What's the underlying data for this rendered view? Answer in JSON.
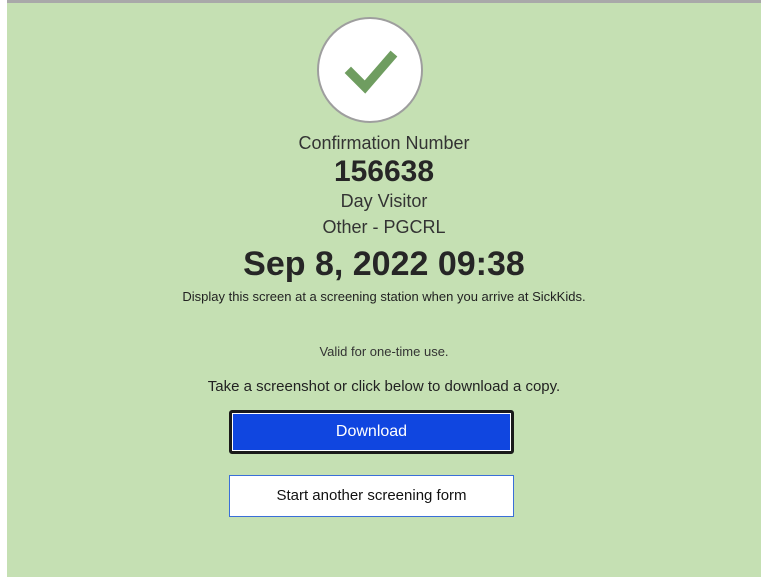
{
  "confirmation": {
    "label": "Confirmation Number",
    "number": "156638",
    "visitor_type": "Day Visitor",
    "category": "Other - PGCRL",
    "datetime": "Sep 8, 2022 09:38"
  },
  "messages": {
    "instruction": "Display this screen at a screening station when you arrive at SickKids.",
    "valid_note": "Valid for one-time use.",
    "screenshot_note": "Take a screenshot or click below to download a copy."
  },
  "buttons": {
    "download_label": "Download",
    "another_label": "Start another screening form"
  },
  "icons": {
    "status": "checkmark-icon"
  },
  "colors": {
    "background": "#c5e0b3",
    "check": "#6f9d60",
    "download_button": "#1046e0"
  }
}
